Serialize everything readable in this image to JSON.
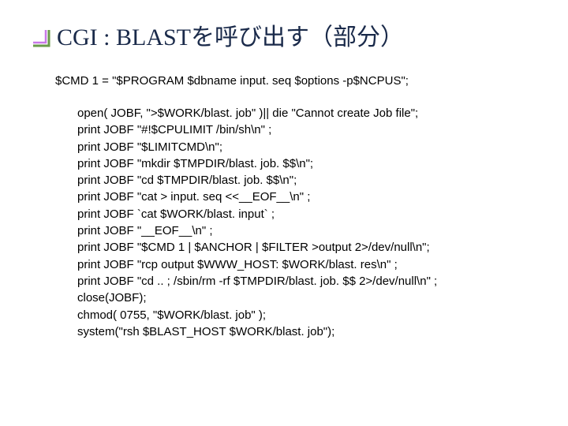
{
  "title": "CGI : BLASTを呼び出す（部分）",
  "cmd1": "$CMD 1 = \"$PROGRAM $dbname input. seq $options -p$NCPUS\";",
  "code": [
    "open( JOBF, \">$WORK/blast. job\" )|| die \"Cannot create Job file\";",
    "print JOBF \"#!$CPULIMIT /bin/sh\\n\" ;",
    "print JOBF \"$LIMITCMD\\n\";",
    "print JOBF \"mkdir $TMPDIR/blast. job. $$\\n\";",
    "print JOBF \"cd $TMPDIR/blast. job. $$\\n\";",
    "print JOBF \"cat > input. seq <<__EOF__\\n\" ;",
    "print JOBF `cat $WORK/blast. input` ;",
    "print JOBF \"__EOF__\\n\" ;",
    "print JOBF \"$CMD 1 | $ANCHOR | $FILTER >output 2>/dev/null\\n\";",
    "print JOBF \"rcp output $WWW_HOST: $WORK/blast. res\\n\" ;",
    "print JOBF \"cd .. ; /sbin/rm -rf $TMPDIR/blast. job. $$ 2>/dev/null\\n\" ;",
    "close(JOBF);",
    "chmod( 0755, \"$WORK/blast. job\" );",
    "system(\"rsh $BLAST_HOST $WORK/blast. job\");"
  ]
}
